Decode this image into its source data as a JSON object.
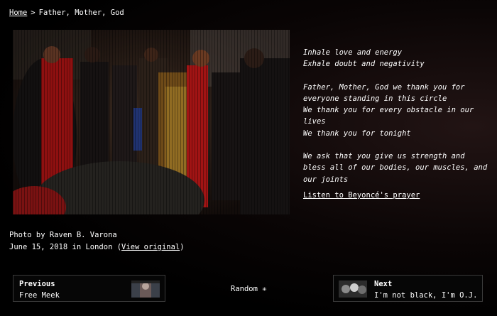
{
  "breadcrumb": {
    "home": "Home",
    "separator": ">",
    "current": "Father, Mother, God"
  },
  "poem": {
    "stanzas": [
      [
        "Inhale love and energy",
        "Exhale doubt and negativity"
      ],
      [
        "Father, Mother, God we thank you for",
        "everyone standing in this circle",
        "We thank you for every obstacle in our",
        "lives",
        "We thank you for tonight"
      ],
      [
        "We ask that you give us strength and",
        "bless all of our bodies, our muscles, and",
        "our joints"
      ]
    ]
  },
  "prayer_link": "Listen to Beyoncé's prayer",
  "credit": {
    "photo_by": "Photo by Raven B. Varona",
    "date_location": "June 15, 2018 in London (",
    "view_original": "View original",
    "close_paren": ")"
  },
  "nav": {
    "previous_label": "Previous",
    "previous_title": "Free Meek",
    "random": "Random ✳",
    "next_label": "Next",
    "next_title": "I'm not black, I'm O.J."
  }
}
